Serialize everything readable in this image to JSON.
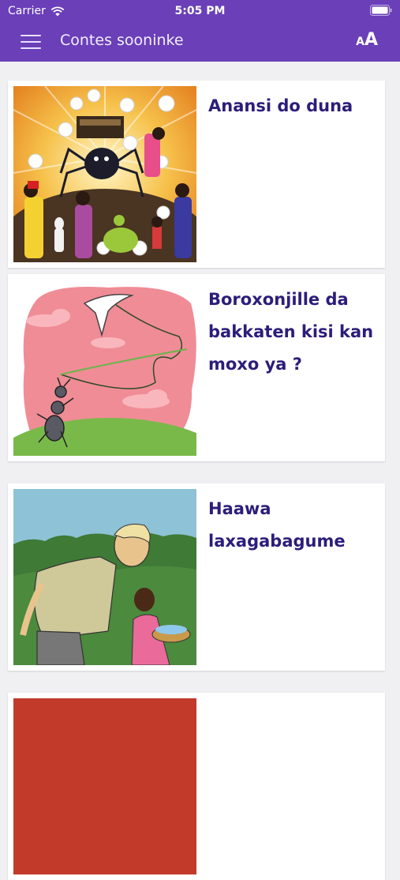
{
  "status_bar": {
    "carrier": "Carrier",
    "time": "5:05 PM"
  },
  "app_bar": {
    "title": "Contes sooninke",
    "font_size_icon": "text-size-icon",
    "menu_icon": "hamburger-menu-icon"
  },
  "stories": [
    {
      "title": "Anansi do duna"
    },
    {
      "title": "Boroxonjille da bakkaten kisi kan moxo ya ?"
    },
    {
      "title": "Haawa laxagabagume"
    },
    {
      "title": ""
    }
  ],
  "colors": {
    "accent": "#6a3fb8",
    "title_text": "#2c1d7a"
  }
}
